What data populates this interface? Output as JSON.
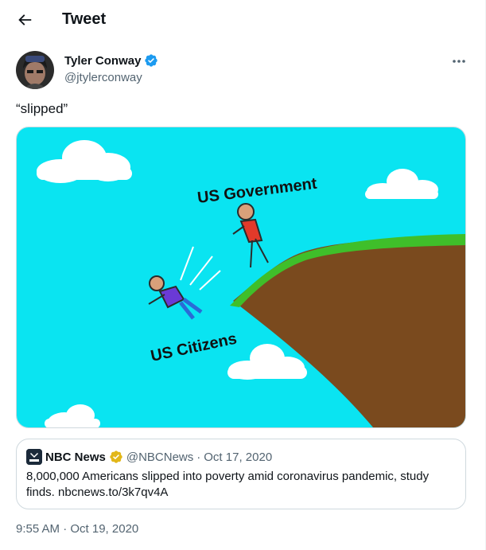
{
  "header": {
    "back_icon": "arrow-left-icon",
    "title": "Tweet"
  },
  "tweet": {
    "author": {
      "name": "Tyler Conway",
      "handle": "@jtylerconway",
      "verified_icon": "verified-badge-icon",
      "verified_color": "#1d9bf0"
    },
    "more_icon": "more-horizontal-icon",
    "text": "“slipped”",
    "media": {
      "labels": {
        "top": "US Government",
        "bottom": "US Citizens"
      },
      "colors": {
        "sky": "#0ae4f1",
        "cliff": "#7a4a1e",
        "grass": "#3fbf2a",
        "cloud": "#ffffff"
      }
    },
    "quote": {
      "source_name": "NBC News",
      "source_handle": "@NBCNews",
      "separator": "·",
      "date": "Oct 17, 2020",
      "badge_icon": "gold-verified-badge-icon",
      "badge_color": "#e2b719",
      "text": "8,000,000 Americans slipped into poverty amid coronavirus pandemic, study finds. nbcnews.to/3k7qv4A"
    },
    "timestamp": "9:55 AM · Oct 19, 2020"
  }
}
